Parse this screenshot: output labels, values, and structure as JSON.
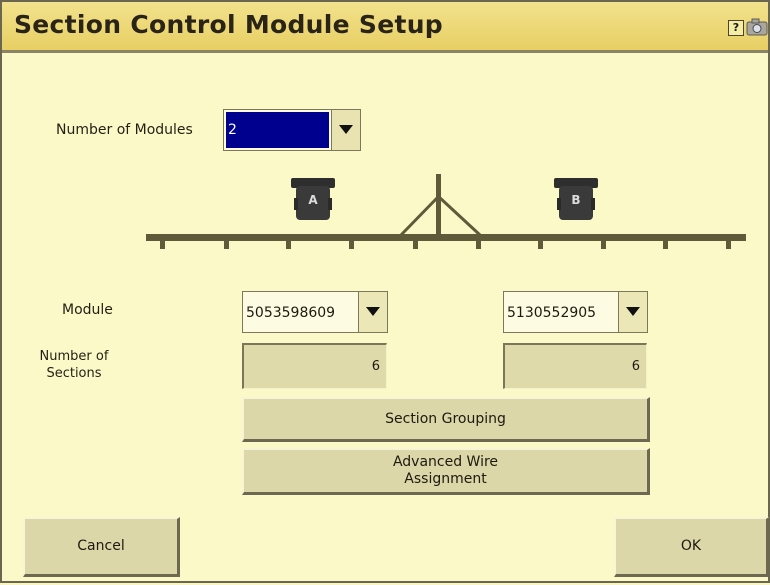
{
  "window": {
    "title": "Section Control Module Setup",
    "help_glyph": "?"
  },
  "modules_count": {
    "label": "Number of Modules",
    "value": "2"
  },
  "diagram": {
    "module_a_label": "A",
    "module_b_label": "B"
  },
  "module_row": {
    "label": "Module",
    "module_a_id": "5053598609",
    "module_b_id": "5130552905"
  },
  "sections_row": {
    "label_line1": "Number of",
    "label_line2": "Sections",
    "module_a_sections": "6",
    "module_b_sections": "6"
  },
  "buttons": {
    "section_grouping": "Section Grouping",
    "advanced_line1": "Advanced Wire",
    "advanced_line2": "Assignment",
    "cancel": "Cancel",
    "ok": "OK"
  },
  "colors": {
    "background": "#fcf9c9",
    "titlebar": "#ebd56d",
    "selected": "#00008f"
  }
}
